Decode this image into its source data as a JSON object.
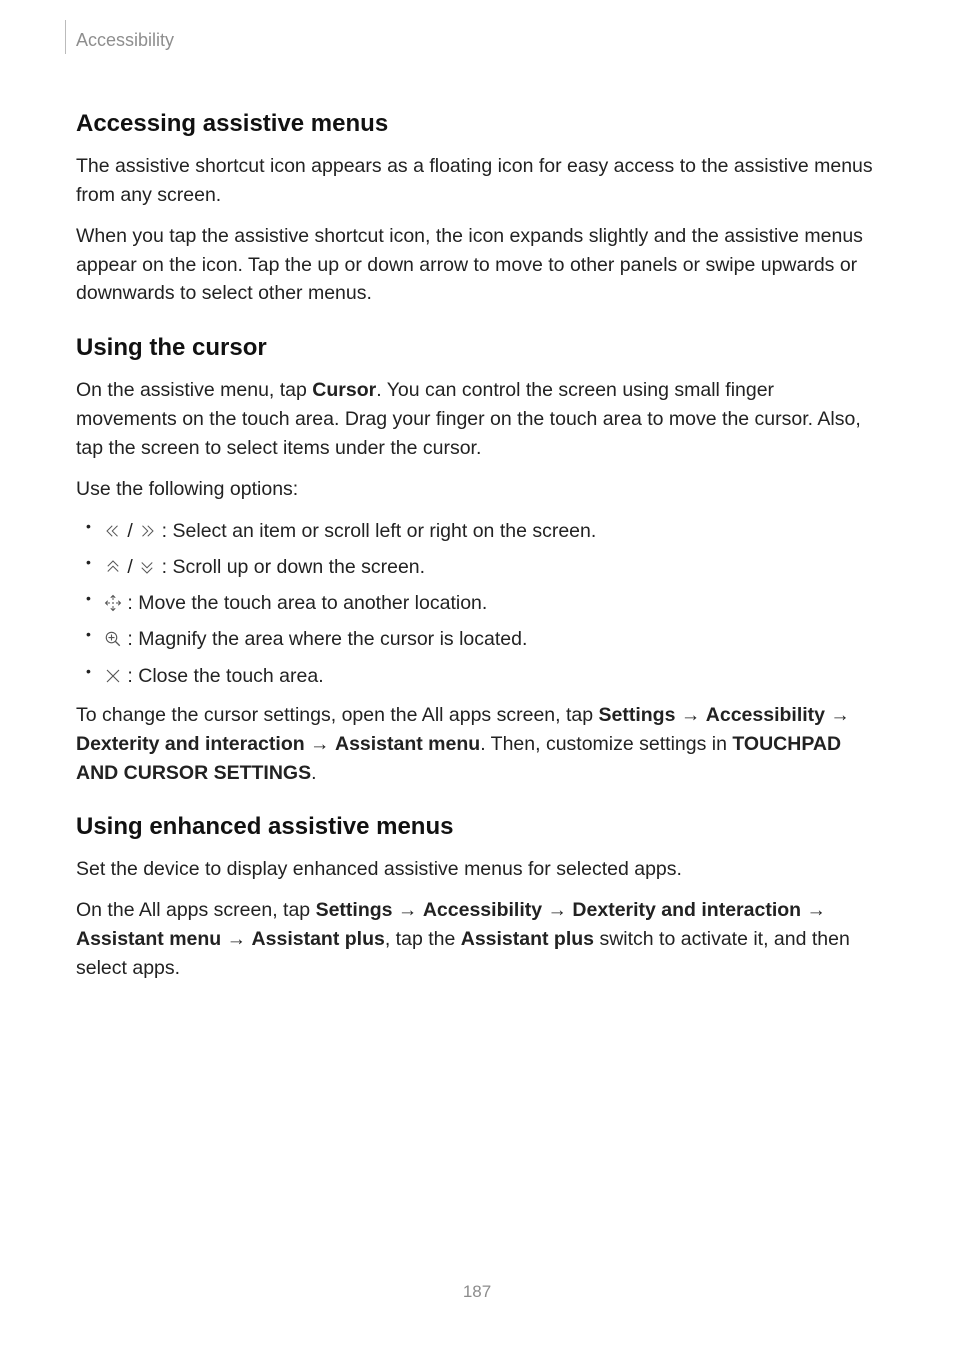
{
  "header": {
    "label": "Accessibility"
  },
  "section1": {
    "heading": "Accessing assistive menus",
    "para1": "The assistive shortcut icon appears as a floating icon for easy access to the assistive menus from any screen.",
    "para2": "When you tap the assistive shortcut icon, the icon expands slightly and the assistive menus appear on the icon. Tap the up or down arrow to move to other panels or swipe upwards or downwards to select other menus."
  },
  "section2": {
    "heading": "Using the cursor",
    "para1_pre": "On the assistive menu, tap ",
    "para1_bold": "Cursor",
    "para1_post": ". You can control the screen using small finger movements on the touch area. Drag your finger on the touch area to move the cursor. Also, tap the screen to select items under the cursor.",
    "para2": "Use the following options:",
    "icons": {
      "slash": " / ",
      "chev_left": "chev-left-double-icon",
      "chev_right": "chev-right-double-icon",
      "chev_up": "chev-up-double-icon",
      "chev_down": "chev-down-double-icon",
      "move": "move-icon",
      "magnify": "magnify-icon",
      "close": "close-x-icon"
    },
    "items": [
      " : Select an item or scroll left or right on the screen.",
      " : Scroll up or down the screen.",
      " : Move the touch area to another location.",
      " : Magnify the area where the cursor is located.",
      " : Close the touch area."
    ],
    "para3": {
      "t0": "To change the cursor settings, open the All apps screen, tap ",
      "b1": "Settings",
      "arr": " → ",
      "b2": "Accessibility",
      "b3": "Dexterity and interaction",
      "b4": "Assistant menu",
      "t1": ". Then, customize settings in ",
      "b5": "TOUCHPAD AND CURSOR SETTINGS",
      "t2": "."
    }
  },
  "section3": {
    "heading": "Using enhanced assistive menus",
    "para1": "Set the device to display enhanced assistive menus for selected apps.",
    "para2": {
      "t0": "On the All apps screen, tap ",
      "b1": "Settings",
      "arr": " → ",
      "b2": "Accessibility",
      "b3": "Dexterity and interaction",
      "b4": "Assistant menu",
      "b5": "Assistant plus",
      "t1": ", tap the ",
      "b6": "Assistant plus",
      "t2": " switch to activate it, and then select apps."
    }
  },
  "page_number": "187"
}
